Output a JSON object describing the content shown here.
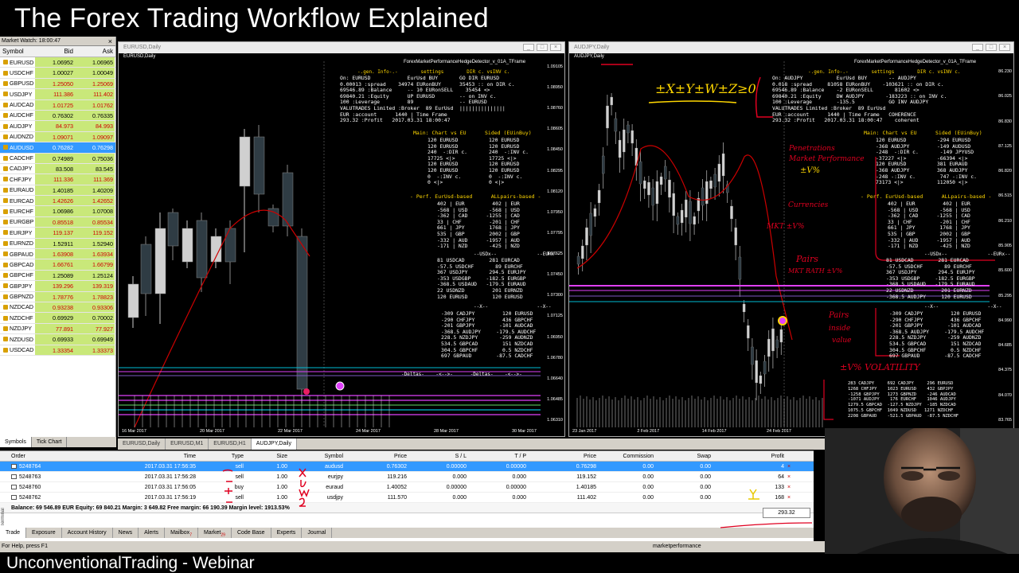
{
  "banner": {
    "title": "The Forex Trading Workflow Explained",
    "footer": "UnconventionalTrading - Webinar"
  },
  "market_watch": {
    "title": "Market Watch: 18:00:47",
    "columns": [
      "Symbol",
      "Bid",
      "Ask"
    ],
    "rows": [
      {
        "symbol": "EURUSD",
        "bid": "1.06952",
        "ask": "1.06965",
        "dir": "up"
      },
      {
        "symbol": "USDCHF",
        "bid": "1.00027",
        "ask": "1.00049",
        "dir": "up"
      },
      {
        "symbol": "GBPUSD",
        "bid": "1.25050",
        "ask": "1.25069",
        "dir": "dn"
      },
      {
        "symbol": "USDJPY",
        "bid": "111.386",
        "ask": "111.402",
        "dir": "dn"
      },
      {
        "symbol": "AUDCAD",
        "bid": "1.01725",
        "ask": "1.01762",
        "dir": "dn"
      },
      {
        "symbol": "AUDCHF",
        "bid": "0.76302",
        "ask": "0.76335",
        "dir": "up"
      },
      {
        "symbol": "AUDJPY",
        "bid": "84.973",
        "ask": "84.993",
        "dir": "dn"
      },
      {
        "symbol": "AUDNZD",
        "bid": "1.09071",
        "ask": "1.09097",
        "dir": "dn"
      },
      {
        "symbol": "AUDUSD",
        "bid": "0.76282",
        "ask": "0.76298",
        "dir": "sel"
      },
      {
        "symbol": "CADCHF",
        "bid": "0.74989",
        "ask": "0.75036",
        "dir": "up"
      },
      {
        "symbol": "CADJPY",
        "bid": "83.508",
        "ask": "83.545",
        "dir": "up"
      },
      {
        "symbol": "CHFJPY",
        "bid": "111.336",
        "ask": "111.369",
        "dir": "dn"
      },
      {
        "symbol": "EURAUD",
        "bid": "1.40185",
        "ask": "1.40209",
        "dir": "up"
      },
      {
        "symbol": "EURCAD",
        "bid": "1.42626",
        "ask": "1.42652",
        "dir": "dn"
      },
      {
        "symbol": "EURCHF",
        "bid": "1.06986",
        "ask": "1.07008",
        "dir": "up"
      },
      {
        "symbol": "EURGBP",
        "bid": "0.85518",
        "ask": "0.85534",
        "dir": "dn"
      },
      {
        "symbol": "EURJPY",
        "bid": "119.137",
        "ask": "119.152",
        "dir": "dn"
      },
      {
        "symbol": "EURNZD",
        "bid": "1.52911",
        "ask": "1.52940",
        "dir": "up"
      },
      {
        "symbol": "GBPAUD",
        "bid": "1.63908",
        "ask": "1.63934",
        "dir": "dn"
      },
      {
        "symbol": "GBPCAD",
        "bid": "1.66761",
        "ask": "1.66799",
        "dir": "dn"
      },
      {
        "symbol": "GBPCHF",
        "bid": "1.25089",
        "ask": "1.25124",
        "dir": "up"
      },
      {
        "symbol": "GBPJPY",
        "bid": "139.296",
        "ask": "139.319",
        "dir": "dn"
      },
      {
        "symbol": "GBPNZD",
        "bid": "1.78776",
        "ask": "1.78823",
        "dir": "dn"
      },
      {
        "symbol": "NZDCAD",
        "bid": "0.93238",
        "ask": "0.93306",
        "dir": "dn"
      },
      {
        "symbol": "NZDCHF",
        "bid": "0.69929",
        "ask": "0.70002",
        "dir": "up"
      },
      {
        "symbol": "NZDJPY",
        "bid": "77.891",
        "ask": "77.927",
        "dir": "dn"
      },
      {
        "symbol": "NZDUSD",
        "bid": "0.69933",
        "ask": "0.69949",
        "dir": "up"
      },
      {
        "symbol": "USDCAD",
        "bid": "1.33354",
        "ask": "1.33373",
        "dir": "dn"
      }
    ],
    "tabs": [
      "Symbols",
      "Tick Chart"
    ]
  },
  "chart_left": {
    "window_title": "EURUSD,Daily",
    "symbol_label": "EURUSD,Daily",
    "indicator": "ForexMarketPerformanceHedgeDetector_v_01A_TFrame",
    "info_head": "-.gen. Info-.-        settings        DIR c. vsINV c.",
    "info": "On: EURUSD            EurUsd BUY       GO DIR EURUSD\n0.00013 :spread    34974 EURonBUY      35453 :: on DIR c.\n69546.89 :Balance     -- 10 EURonSELL    35454 <> \n69840.21 :Equity      UP EURUSD        -- on INV c.\n100 :Leverage         89               -- EURUSD\nVALUTRADES Limited :Broker  89 EurUsd  |||||||||||||||\nEUR :account      1440 | Time Frame\n293.32 :Profit   2017.03.31 18:00:47",
    "main_head": "Main: Chart vs EU      Sided (EUinBuy)",
    "main": "120 EURUSD          120 EURUSD\n120 EURUSD          120 EURUSD\n240  -:DIR c.       240  -:INV c.\n17725 <|>           17725 <|>\n120 EURUSD          120 EURUSD\n120 EURUSD          120 EURUSD\n0  -:INV c.         0  -:INV c.\n0 <|>               0 <|>",
    "perf_head": "- Perf. EurUsd-based      ALLpairs-based -",
    "perf": "402 | EUR         402 | EUR\n-568 | USD       -568 | USD\n-362 | CAD      -1255 | CAD\n33 | CHF         -201 | CHF\n661 | JPY        1768 | JPY\n535 | GBP        2002 | GBP\n-332 | AUD      -1957 | AUD\n-171 | NZD       -425 | NZD",
    "usdx_head": "--USDx--              --EURx--",
    "usdx": "81 USDCAD        281 EURCAD\n-57.5 USDCHF       89 EURCHF\n367 USDJPY       294.5 EURJPY\n-353 USDGBP     -182.5 EURGBP\n-368.5 USDAUD   -179.5 EURAUD\n22 USDNZD         201 EURNZD\n120 EURUSD        120 EURUSD",
    "x_head": "--X--                 --X--",
    "x": "-309 CADJPY         120 EURUSD\n-290 CHFJPY         436 GBPCHF\n-201 GBPJPY        -101 AUDCAD\n-368.5 AUDJPY     -179.5 AUDCHF\n228.5 NZDJPY       -259 AUDNZD\n534.5 GBPCAD        151 NZDCAD\n304.5 GBPCHF        0.5 NZDCHF\n697 GBPAUD        -87.5 CADCHF",
    "deltas_head": "-Deltas-    -<-->-      -Deltas-    -<-->-",
    "prices": [
      "1.09105",
      "1.08950",
      "1.08760",
      "1.08605",
      "1.08450",
      "1.08295",
      "1.08120",
      "1.07950",
      "1.07795",
      "1.07625",
      "1.07450",
      "1.07300",
      "1.07125",
      "1.06950",
      "1.06780",
      "1.06640",
      "1.06485",
      "1.06310"
    ],
    "dates": [
      "16 Mar 2017",
      "20 Mar 2017",
      "22 Mar 2017",
      "24 Mar 2017",
      "28 Mar 2017",
      "30 Mar 2017"
    ]
  },
  "chart_right": {
    "window_title": "AUDJPY,Daily",
    "symbol_label": "AUDJPY,Daily",
    "indicator": "ForexMarketPerformanceHedgeDetector_v_01A_TFrame",
    "info_head": "-.gen. Info-.-        settings        DIR c. vsINV c.",
    "info": "On: AUDJPY           EurUsd BUY       -- AUDJPY\n0.018 :spread     81058 EURonBUY    -103621 :: on DIR c.\n69546.89 :Balance    -2 EURonSELL       81602 <> \n69840.21 :Equity     DW AUDJPY       -183223 :: on INV c.\n100 :Leverage        -135.5           GO INV AUDJPY\nVALUTRADES Limited :Broker  89 EurUsd  \nEUR :account      1440 | Time Frame   COHERENCE\n293.32 :Profit   2017.03.31 18:00:47    coherent",
    "main_head": "Main: Chart vs EU      Sided (EUinBuy)",
    "main": "120 EURUSD          -294 EURUSD\n-368 AUDJPY         -149 AUDUSD\n-248  -:DIR c.       -149 JPYUSD\n-37227 <|>          -66394 <|>\n120 EURUSD          381 EURAUD\n-368 AUDJPY         368 AUDJPY\n-248 -:INV c.        747 -:INV c.\n73173 <|>           112050 <|>",
    "perf_head": "- Perf. EurUsd-based      ALLpairs-based -",
    "perf": "402 | EUR         402 | EUR\n-568 | USD       -568 | USD\n-362 | CAD      -1255 | CAD\n33 | CHF         -201 | CHF\n661 | JPY        1768 | JPY\n535 | GBP        2002 | GBP\n-332 | AUD      -1957 | AUD\n-171 | NZD       -425 | NZD",
    "usdx_head": "--USDx--              --EURx--",
    "usdx": "81 USDCAD        281 EURCAD\n-57.5 USDCHF       89 EURCHF\n367 USDJPY       294.5 EURJPY\n-353 USDGBP     -182.5 EURGBP\n-368.5 USDAUD   -179.5 EURAUD\n22 USDNZD         201 EURNZD\n-368.5 AUDJPY     120 EURUSD",
    "x_head": "--X--                 --X--",
    "x": "-309 CADJPY         120 EURUSD\n-290 CHFJPY         436 GBPCHF\n-201 GBPJPY        -101 AUDCAD\n-368.5 AUDJPY     -179.5 AUDCHF\n228.5 NZDJPY       -259 AUDNZD\n534.5 GBPCAD        151 NZDCAD\n304.5 GBPCHF        0.5 NZDCHF\n697 GBPAUD        -87.5 CADCHF",
    "deltas": "283 CADJPY     692 CADJPY     296 EURUSD\n1268 CHFJPY    1023 EURUSD    432 GBPJPY\n-1258 GBPJPY   1273 GBPNZD    -246 AUDCAD\n-1071 AUDJPY    176 EURCHF    1046 AUDJPY\n1279.5 GBPCAD  -127.5 NZDJPY  -185 NZDCAD\n1075.5 GBPCHF  1049 NZDUSD   1271 NZDCHF\n2208 GBPAUD    -521.5 GBPAUD  -87.5 NZDCHF",
    "annotations": [
      "±X±Y±W±Z≥0",
      "Penetrations",
      "Market Performance",
      "±V%",
      "Currencies",
      "MKT ±V%",
      "Pairs",
      "MKT RATH ±V%",
      "Pairs",
      "inside",
      "value",
      "±V%  VOLATILITY"
    ],
    "prices": [
      "86.230",
      "86.025",
      "86.830",
      "87.125",
      "86.820",
      "86.515",
      "86.210",
      "85.905",
      "85.600",
      "85.295",
      "84.990",
      "84.685",
      "84.375",
      "84.070",
      "83.765"
    ],
    "dates": [
      "23 Jan 2017",
      "2 Feb 2017",
      "14 Feb 2017",
      "24 Feb 2017",
      "8 Mar 2017",
      "20 Mar 2017",
      "30 Mar 2017"
    ]
  },
  "chart_tabs": [
    "EURUSD,Daily",
    "EURUSD,M1",
    "EURUSD,H1",
    "AUDJPY,Daily"
  ],
  "terminal": {
    "columns": [
      "Order",
      "Time",
      "Type",
      "Size",
      "Symbol",
      "Price",
      "S / L",
      "T / P",
      "Price",
      "Commission",
      "Swap",
      "Profit"
    ],
    "rows": [
      {
        "order": "5248764",
        "time": "2017.03.31 17:56:35",
        "type": "sell",
        "size": "1.00",
        "symbol": "audusd",
        "price": "0.76302",
        "sl": "0.00000",
        "tp": "0.00000",
        "price2": "0.76298",
        "commission": "0.00",
        "swap": "0.00",
        "profit": "4"
      },
      {
        "order": "5248763",
        "time": "2017.03.31 17:56:28",
        "type": "sell",
        "size": "1.00",
        "symbol": "eurjpy",
        "price": "119.216",
        "sl": "0.000",
        "tp": "0.000",
        "price2": "119.152",
        "commission": "0.00",
        "swap": "0.00",
        "profit": "64"
      },
      {
        "order": "5248760",
        "time": "2017.03.31 17:56:05",
        "type": "buy",
        "size": "1.00",
        "symbol": "euraud",
        "price": "1.40052",
        "sl": "0.00000",
        "tp": "0.00000",
        "price2": "1.40185",
        "commission": "0.00",
        "swap": "0.00",
        "profit": "133"
      },
      {
        "order": "5248762",
        "time": "2017.03.31 17:56:19",
        "type": "sell",
        "size": "1.00",
        "symbol": "usdjpy",
        "price": "111.570",
        "sl": "0.000",
        "tp": "0.000",
        "price2": "111.402",
        "commission": "0.00",
        "swap": "0.00",
        "profit": "168"
      }
    ],
    "balance": "Balance: 69 546.89 EUR  Equity: 69 840.21  Margin: 3 649.82  Free margin: 66 190.39  Margin level: 1913.53%",
    "total_profit": "293.32",
    "side_label": "Terminal",
    "tabs": [
      "Trade",
      "Exposure",
      "Account History",
      "News",
      "Alerts",
      "Mailbox",
      "Market",
      "Code Base",
      "Experts",
      "Journal"
    ],
    "mailbox_count": "7",
    "market_count": "29"
  },
  "status": {
    "left": "For Help, press F1",
    "right": "marketperformance"
  }
}
